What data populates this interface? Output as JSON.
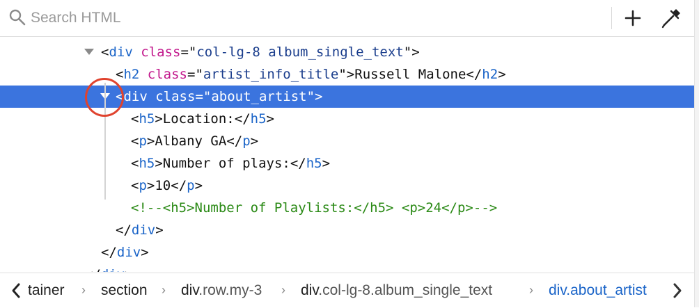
{
  "toolbar": {
    "search_placeholder": "Search HTML",
    "icons": [
      "search-icon",
      "plus-icon",
      "eyedropper-icon"
    ]
  },
  "tree": {
    "rows": [
      {
        "twisty": "expanded",
        "parts": [
          [
            "punc",
            "<"
          ],
          [
            "tag",
            "div"
          ],
          [
            "punc",
            " "
          ],
          [
            "attr",
            "class"
          ],
          [
            "punc",
            "=\""
          ],
          [
            "val",
            "col-lg-8 album_single_text"
          ],
          [
            "punc",
            "\">"
          ]
        ]
      },
      {
        "twisty": "none",
        "parts": [
          [
            "punc",
            "<"
          ],
          [
            "tag",
            "h2"
          ],
          [
            "punc",
            " "
          ],
          [
            "attr",
            "class"
          ],
          [
            "punc",
            "=\""
          ],
          [
            "val",
            "artist_info_title"
          ],
          [
            "punc",
            "\">"
          ],
          [
            "txt",
            "Russell Malone"
          ],
          [
            "punc",
            "</"
          ],
          [
            "tag",
            "h2"
          ],
          [
            "punc",
            ">"
          ]
        ]
      },
      {
        "twisty": "expanded",
        "selected": true,
        "parts": [
          [
            "punc",
            "<"
          ],
          [
            "tag",
            "div"
          ],
          [
            "punc",
            " "
          ],
          [
            "attr",
            "class"
          ],
          [
            "punc",
            "=\""
          ],
          [
            "val",
            "about_artist"
          ],
          [
            "punc",
            "\">"
          ]
        ]
      },
      {
        "twisty": "none",
        "parts": [
          [
            "punc",
            "<"
          ],
          [
            "tag",
            "h5"
          ],
          [
            "punc",
            ">"
          ],
          [
            "txt",
            "Location:"
          ],
          [
            "punc",
            "</"
          ],
          [
            "tag",
            "h5"
          ],
          [
            "punc",
            ">"
          ]
        ]
      },
      {
        "twisty": "none",
        "parts": [
          [
            "punc",
            "<"
          ],
          [
            "tag",
            "p"
          ],
          [
            "punc",
            ">"
          ],
          [
            "txt",
            "Albany GA"
          ],
          [
            "punc",
            "</"
          ],
          [
            "tag",
            "p"
          ],
          [
            "punc",
            ">"
          ]
        ]
      },
      {
        "twisty": "none",
        "parts": [
          [
            "punc",
            "<"
          ],
          [
            "tag",
            "h5"
          ],
          [
            "punc",
            ">"
          ],
          [
            "txt",
            "Number of plays:"
          ],
          [
            "punc",
            "</"
          ],
          [
            "tag",
            "h5"
          ],
          [
            "punc",
            ">"
          ]
        ]
      },
      {
        "twisty": "none",
        "parts": [
          [
            "punc",
            "<"
          ],
          [
            "tag",
            "p"
          ],
          [
            "punc",
            ">"
          ],
          [
            "txt",
            "10"
          ],
          [
            "punc",
            "</"
          ],
          [
            "tag",
            "p"
          ],
          [
            "punc",
            ">"
          ]
        ]
      },
      {
        "twisty": "none",
        "parts": [
          [
            "cmt",
            "<!--<h5>Number of Playlists:</h5> <p>24</p>-->"
          ]
        ]
      },
      {
        "twisty": "none",
        "parts": [
          [
            "punc",
            "</"
          ],
          [
            "tag",
            "div"
          ],
          [
            "punc",
            ">"
          ]
        ]
      },
      {
        "twisty": "none",
        "parts": [
          [
            "punc",
            "</"
          ],
          [
            "tag",
            "div"
          ],
          [
            "punc",
            ">"
          ]
        ]
      },
      {
        "twisty": "none",
        "parts": [
          [
            "punc",
            "</"
          ],
          [
            "tag",
            "div"
          ],
          [
            "punc",
            ">"
          ]
        ]
      }
    ]
  },
  "breadcrumbs": {
    "items": [
      {
        "tag": "tainer",
        "rest": "",
        "active": false
      },
      {
        "tag": "section",
        "rest": "",
        "active": false
      },
      {
        "tag": "div",
        "rest": ".row.my-3",
        "active": false
      },
      {
        "tag": "div",
        "rest": ".col-lg-8.album_single_text",
        "active": false
      },
      {
        "tag": "div",
        "rest": ".about_artist",
        "active": true
      }
    ],
    "icons": [
      "chevron-left-icon",
      "chevron-right-icon"
    ]
  },
  "colors": {
    "selection": "#3b74de",
    "tag": "#1a64c8",
    "attribute": "#c2188c",
    "attribute_value": "#1a3d8c",
    "comment": "#2b8a16",
    "annotation_circle": "#e0432e"
  }
}
